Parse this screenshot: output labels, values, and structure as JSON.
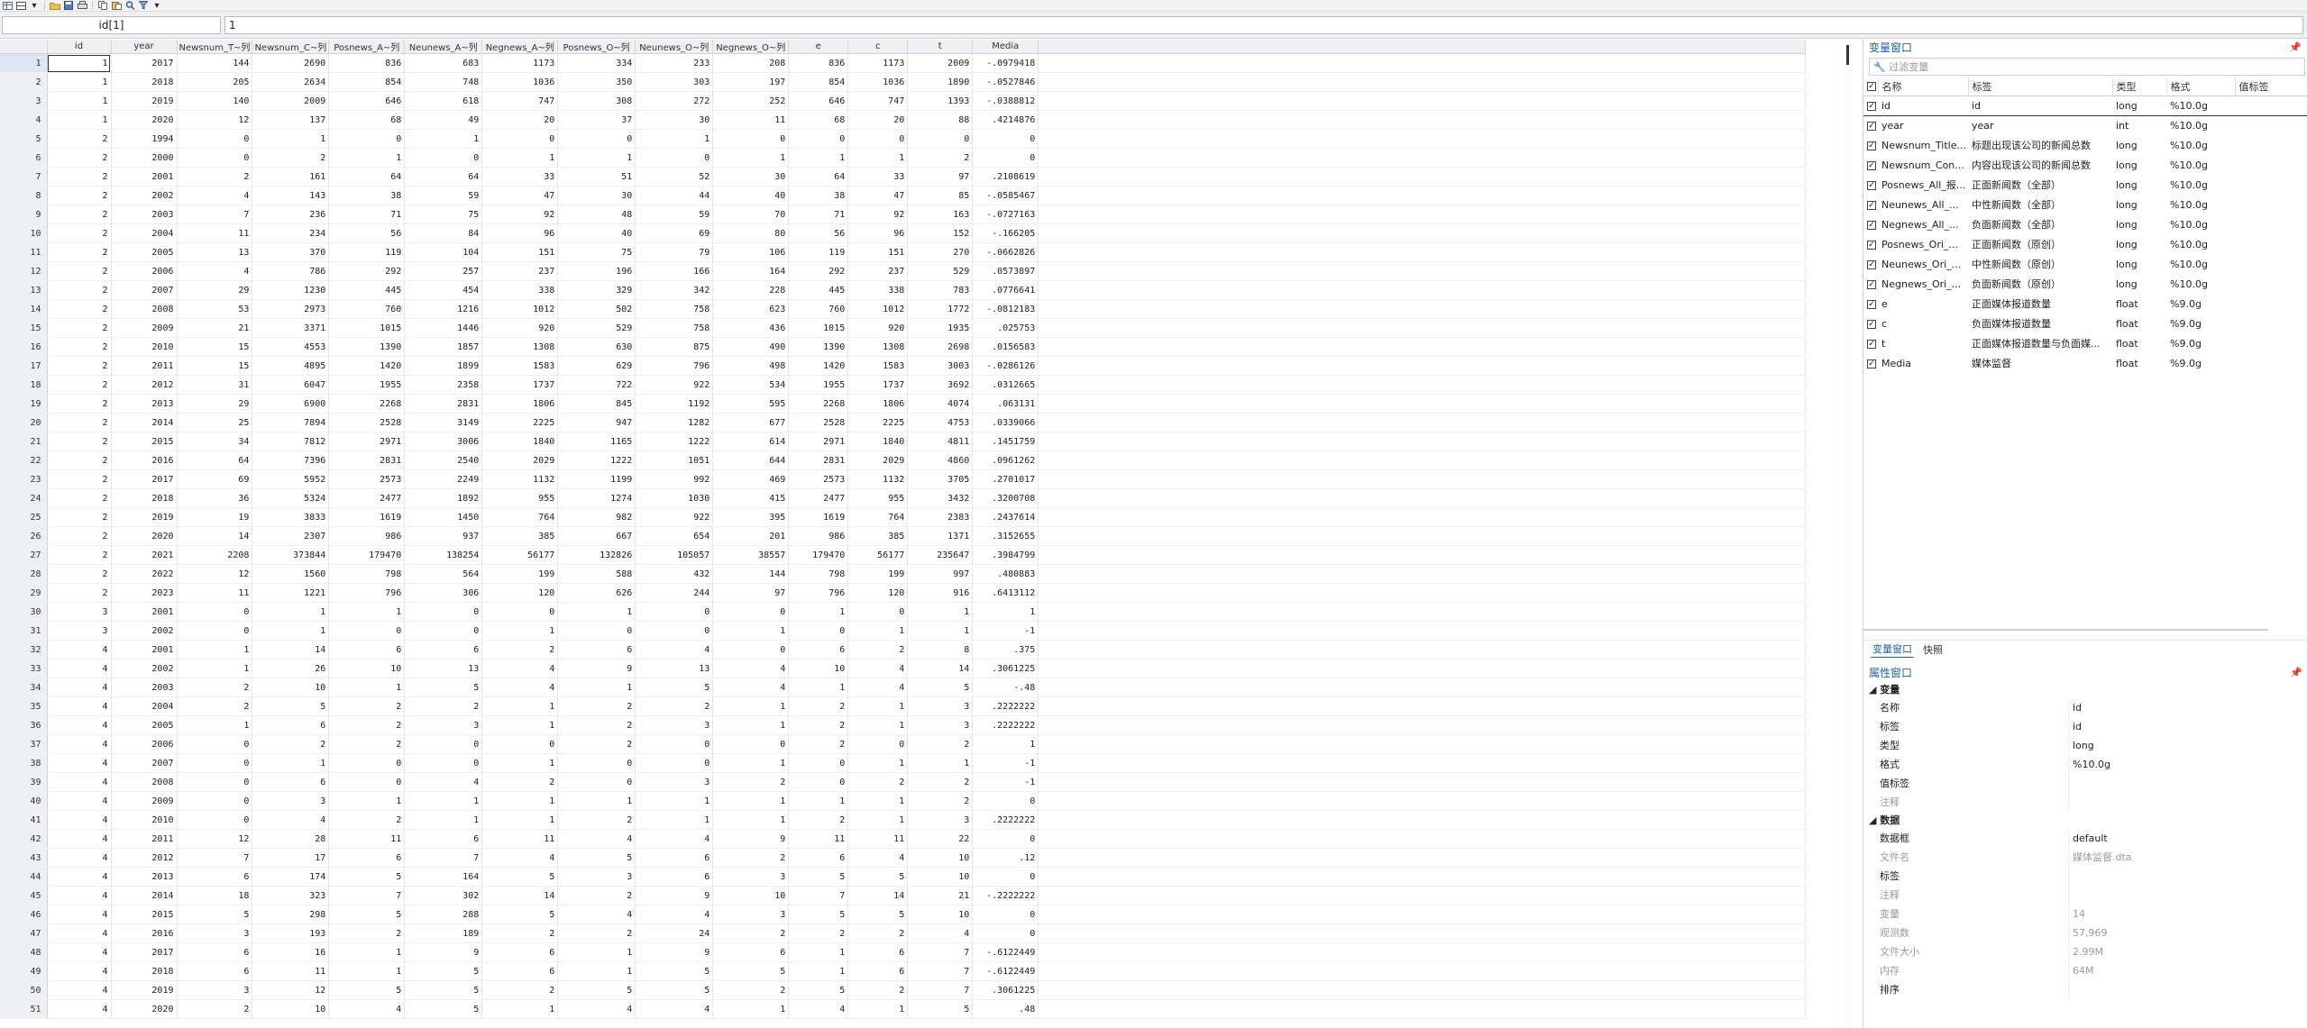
{
  "toolbar": {
    "icons": [
      "table-view-icon",
      "grid-icon",
      "dropdown-icon",
      "folder-icon",
      "save-icon",
      "print-icon",
      "copy-icon",
      "paste-icon",
      "search-icon",
      "filter-icon",
      "dropdown-icon"
    ]
  },
  "command": {
    "varname": "id[1]",
    "value": "1"
  },
  "grid": {
    "columns": [
      "id",
      "year",
      "Newsnum_T~列",
      "Newsnum_C~列",
      "Posnews_A~列",
      "Neunews_A~列",
      "Negnews_A~列",
      "Posnews_O~列",
      "Neunews_O~列",
      "Negnews_O~列",
      "e",
      "c",
      "t",
      "Media"
    ],
    "rows": [
      [
        "1",
        "2017",
        "144",
        "2690",
        "836",
        "683",
        "1173",
        "334",
        "233",
        "208",
        "836",
        "1173",
        "2009",
        "-.0979418"
      ],
      [
        "1",
        "2018",
        "205",
        "2634",
        "854",
        "748",
        "1036",
        "350",
        "303",
        "197",
        "854",
        "1036",
        "1890",
        "-.0527846"
      ],
      [
        "1",
        "2019",
        "140",
        "2009",
        "646",
        "618",
        "747",
        "308",
        "272",
        "252",
        "646",
        "747",
        "1393",
        "-.0388812"
      ],
      [
        "1",
        "2020",
        "12",
        "137",
        "68",
        "49",
        "20",
        "37",
        "30",
        "11",
        "68",
        "20",
        "88",
        ".4214876"
      ],
      [
        "2",
        "1994",
        "0",
        "1",
        "0",
        "1",
        "0",
        "0",
        "1",
        "0",
        "0",
        "0",
        "0",
        "0"
      ],
      [
        "2",
        "2000",
        "0",
        "2",
        "1",
        "0",
        "1",
        "1",
        "0",
        "1",
        "1",
        "1",
        "2",
        "0"
      ],
      [
        "2",
        "2001",
        "2",
        "161",
        "64",
        "64",
        "33",
        "51",
        "52",
        "30",
        "64",
        "33",
        "97",
        ".2108619"
      ],
      [
        "2",
        "2002",
        "4",
        "143",
        "38",
        "59",
        "47",
        "30",
        "44",
        "40",
        "38",
        "47",
        "85",
        "-.0585467"
      ],
      [
        "2",
        "2003",
        "7",
        "236",
        "71",
        "75",
        "92",
        "48",
        "59",
        "70",
        "71",
        "92",
        "163",
        "-.0727163"
      ],
      [
        "2",
        "2004",
        "11",
        "234",
        "56",
        "84",
        "96",
        "40",
        "69",
        "80",
        "56",
        "96",
        "152",
        "-.166205"
      ],
      [
        "2",
        "2005",
        "13",
        "370",
        "119",
        "104",
        "151",
        "75",
        "79",
        "106",
        "119",
        "151",
        "270",
        "-.0662826"
      ],
      [
        "2",
        "2006",
        "4",
        "786",
        "292",
        "257",
        "237",
        "196",
        "166",
        "164",
        "292",
        "237",
        "529",
        ".0573897"
      ],
      [
        "2",
        "2007",
        "29",
        "1230",
        "445",
        "454",
        "338",
        "329",
        "342",
        "228",
        "445",
        "338",
        "783",
        ".0776641"
      ],
      [
        "2",
        "2008",
        "53",
        "2973",
        "760",
        "1216",
        "1012",
        "502",
        "758",
        "623",
        "760",
        "1012",
        "1772",
        "-.0812183"
      ],
      [
        "2",
        "2009",
        "21",
        "3371",
        "1015",
        "1446",
        "920",
        "529",
        "758",
        "436",
        "1015",
        "920",
        "1935",
        ".025753"
      ],
      [
        "2",
        "2010",
        "15",
        "4553",
        "1390",
        "1857",
        "1308",
        "630",
        "875",
        "490",
        "1390",
        "1308",
        "2698",
        ".0156583"
      ],
      [
        "2",
        "2011",
        "15",
        "4895",
        "1420",
        "1899",
        "1583",
        "629",
        "796",
        "498",
        "1420",
        "1583",
        "3003",
        "-.0286126"
      ],
      [
        "2",
        "2012",
        "31",
        "6047",
        "1955",
        "2358",
        "1737",
        "722",
        "922",
        "534",
        "1955",
        "1737",
        "3692",
        ".0312665"
      ],
      [
        "2",
        "2013",
        "29",
        "6900",
        "2268",
        "2831",
        "1806",
        "845",
        "1192",
        "595",
        "2268",
        "1806",
        "4074",
        ".063131"
      ],
      [
        "2",
        "2014",
        "25",
        "7894",
        "2528",
        "3149",
        "2225",
        "947",
        "1282",
        "677",
        "2528",
        "2225",
        "4753",
        ".0339066"
      ],
      [
        "2",
        "2015",
        "34",
        "7812",
        "2971",
        "3006",
        "1840",
        "1165",
        "1222",
        "614",
        "2971",
        "1840",
        "4811",
        ".1451759"
      ],
      [
        "2",
        "2016",
        "64",
        "7396",
        "2831",
        "2540",
        "2029",
        "1222",
        "1051",
        "644",
        "2831",
        "2029",
        "4860",
        ".0961262"
      ],
      [
        "2",
        "2017",
        "69",
        "5952",
        "2573",
        "2249",
        "1132",
        "1199",
        "992",
        "469",
        "2573",
        "1132",
        "3705",
        ".2701017"
      ],
      [
        "2",
        "2018",
        "36",
        "5324",
        "2477",
        "1892",
        "955",
        "1274",
        "1030",
        "415",
        "2477",
        "955",
        "3432",
        ".3200708"
      ],
      [
        "2",
        "2019",
        "19",
        "3833",
        "1619",
        "1450",
        "764",
        "982",
        "922",
        "395",
        "1619",
        "764",
        "2383",
        ".2437614"
      ],
      [
        "2",
        "2020",
        "14",
        "2307",
        "986",
        "937",
        "385",
        "667",
        "654",
        "201",
        "986",
        "385",
        "1371",
        ".3152655"
      ],
      [
        "2",
        "2021",
        "2208",
        "373844",
        "179470",
        "138254",
        "56177",
        "132826",
        "105057",
        "38557",
        "179470",
        "56177",
        "235647",
        ".3984799"
      ],
      [
        "2",
        "2022",
        "12",
        "1560",
        "798",
        "564",
        "199",
        "588",
        "432",
        "144",
        "798",
        "199",
        "997",
        ".480883"
      ],
      [
        "2",
        "2023",
        "11",
        "1221",
        "796",
        "306",
        "120",
        "626",
        "244",
        "97",
        "796",
        "120",
        "916",
        ".6413112"
      ],
      [
        "3",
        "2001",
        "0",
        "1",
        "1",
        "0",
        "0",
        "1",
        "0",
        "0",
        "1",
        "0",
        "1",
        "1"
      ],
      [
        "3",
        "2002",
        "0",
        "1",
        "0",
        "0",
        "1",
        "0",
        "0",
        "1",
        "0",
        "1",
        "1",
        "-1"
      ],
      [
        "4",
        "2001",
        "1",
        "14",
        "6",
        "6",
        "2",
        "6",
        "4",
        "0",
        "6",
        "2",
        "8",
        ".375"
      ],
      [
        "4",
        "2002",
        "1",
        "26",
        "10",
        "13",
        "4",
        "9",
        "13",
        "4",
        "10",
        "4",
        "14",
        ".3061225"
      ],
      [
        "4",
        "2003",
        "2",
        "10",
        "1",
        "5",
        "4",
        "1",
        "5",
        "4",
        "1",
        "4",
        "5",
        "-.48"
      ],
      [
        "4",
        "2004",
        "2",
        "5",
        "2",
        "2",
        "1",
        "2",
        "2",
        "1",
        "2",
        "1",
        "3",
        ".2222222"
      ],
      [
        "4",
        "2005",
        "1",
        "6",
        "2",
        "3",
        "1",
        "2",
        "3",
        "1",
        "2",
        "1",
        "3",
        ".2222222"
      ],
      [
        "4",
        "2006",
        "0",
        "2",
        "2",
        "0",
        "0",
        "2",
        "0",
        "0",
        "2",
        "0",
        "2",
        "1"
      ],
      [
        "4",
        "2007",
        "0",
        "1",
        "0",
        "0",
        "1",
        "0",
        "0",
        "1",
        "0",
        "1",
        "1",
        "-1"
      ],
      [
        "4",
        "2008",
        "0",
        "6",
        "0",
        "4",
        "2",
        "0",
        "3",
        "2",
        "0",
        "2",
        "2",
        "-1"
      ],
      [
        "4",
        "2009",
        "0",
        "3",
        "1",
        "1",
        "1",
        "1",
        "1",
        "1",
        "1",
        "1",
        "2",
        "0"
      ],
      [
        "4",
        "2010",
        "0",
        "4",
        "2",
        "1",
        "1",
        "2",
        "1",
        "1",
        "2",
        "1",
        "3",
        ".2222222"
      ],
      [
        "4",
        "2011",
        "12",
        "28",
        "11",
        "6",
        "11",
        "4",
        "4",
        "9",
        "11",
        "11",
        "22",
        "0"
      ],
      [
        "4",
        "2012",
        "7",
        "17",
        "6",
        "7",
        "4",
        "5",
        "6",
        "2",
        "6",
        "4",
        "10",
        ".12"
      ],
      [
        "4",
        "2013",
        "6",
        "174",
        "5",
        "164",
        "5",
        "3",
        "6",
        "3",
        "5",
        "5",
        "10",
        "0"
      ],
      [
        "4",
        "2014",
        "18",
        "323",
        "7",
        "302",
        "14",
        "2",
        "9",
        "10",
        "7",
        "14",
        "21",
        "-.2222222"
      ],
      [
        "4",
        "2015",
        "5",
        "298",
        "5",
        "288",
        "5",
        "4",
        "4",
        "3",
        "5",
        "5",
        "10",
        "0"
      ],
      [
        "4",
        "2016",
        "3",
        "193",
        "2",
        "189",
        "2",
        "2",
        "24",
        "2",
        "2",
        "2",
        "4",
        "0"
      ],
      [
        "4",
        "2017",
        "6",
        "16",
        "1",
        "9",
        "6",
        "1",
        "9",
        "6",
        "1",
        "6",
        "7",
        "-.6122449"
      ],
      [
        "4",
        "2018",
        "6",
        "11",
        "1",
        "5",
        "6",
        "1",
        "5",
        "5",
        "1",
        "6",
        "7",
        "-.6122449"
      ],
      [
        "4",
        "2019",
        "3",
        "12",
        "5",
        "5",
        "2",
        "5",
        "5",
        "2",
        "5",
        "2",
        "7",
        ".3061225"
      ],
      [
        "4",
        "2020",
        "2",
        "10",
        "4",
        "5",
        "1",
        "4",
        "4",
        "1",
        "4",
        "1",
        "5",
        ".48"
      ]
    ]
  },
  "varpanel": {
    "title": "变量窗口",
    "filter_placeholder": "过滤变量",
    "headers": {
      "name": "名称",
      "label": "标签",
      "type": "类型",
      "format": "格式",
      "vallabel": "值标签"
    },
    "vars": [
      {
        "name": "id",
        "label": "id",
        "type": "long",
        "format": "%10.0g"
      },
      {
        "name": "year",
        "label": "year",
        "type": "int",
        "format": "%10.0g"
      },
      {
        "name": "Newsnum_Title...",
        "label": "标题出现该公司的新闻总数",
        "type": "long",
        "format": "%10.0g"
      },
      {
        "name": "Newsnum_Con...",
        "label": "内容出现该公司的新闻总数",
        "type": "long",
        "format": "%10.0g"
      },
      {
        "name": "Posnews_All_报...",
        "label": "正面新闻数（全部）",
        "type": "long",
        "format": "%10.0g"
      },
      {
        "name": "Neunews_All_...",
        "label": "中性新闻数（全部）",
        "type": "long",
        "format": "%10.0g"
      },
      {
        "name": "Negnews_All_...",
        "label": "负面新闻数（全部）",
        "type": "long",
        "format": "%10.0g"
      },
      {
        "name": "Posnews_Ori_...",
        "label": "正面新闻数（原创）",
        "type": "long",
        "format": "%10.0g"
      },
      {
        "name": "Neunews_Ori_...",
        "label": "中性新闻数（原创）",
        "type": "long",
        "format": "%10.0g"
      },
      {
        "name": "Negnews_Ori_...",
        "label": "负面新闻数（原创）",
        "type": "long",
        "format": "%10.0g"
      },
      {
        "name": "e",
        "label": "正面媒体报道数量",
        "type": "float",
        "format": "%9.0g"
      },
      {
        "name": "c",
        "label": "负面媒体报道数量",
        "type": "float",
        "format": "%9.0g"
      },
      {
        "name": "t",
        "label": "正面媒体报道数量与负面媒...",
        "type": "float",
        "format": "%9.0g"
      },
      {
        "name": "Media",
        "label": "媒体监督",
        "type": "float",
        "format": "%9.0g"
      }
    ]
  },
  "tabs": {
    "vars": "变量窗口",
    "snapshot": "快照"
  },
  "props": {
    "title": "属性窗口",
    "var_section": "变量",
    "var_rows": [
      {
        "k": "名称",
        "v": "id",
        "dim": false
      },
      {
        "k": "标签",
        "v": "id",
        "dim": false
      },
      {
        "k": "类型",
        "v": "long",
        "dim": false
      },
      {
        "k": "格式",
        "v": "%10.0g",
        "dim": false
      },
      {
        "k": "值标签",
        "v": "",
        "dim": false
      },
      {
        "k": "注释",
        "v": "",
        "dim": true
      }
    ],
    "data_section": "数据",
    "data_rows": [
      {
        "k": "数据框",
        "v": "default",
        "dim": false
      },
      {
        "k": "文件名",
        "v": "媒体监督.dta",
        "dim": true
      },
      {
        "k": "标签",
        "v": "",
        "dim": false
      },
      {
        "k": "注释",
        "v": "",
        "dim": true
      },
      {
        "k": "变量",
        "v": "14",
        "dim": true
      },
      {
        "k": "观测数",
        "v": "57,969",
        "dim": true
      },
      {
        "k": "文件大小",
        "v": "2.99M",
        "dim": true
      },
      {
        "k": "内存",
        "v": "64M",
        "dim": true
      },
      {
        "k": "排序",
        "v": "",
        "dim": false
      }
    ]
  }
}
